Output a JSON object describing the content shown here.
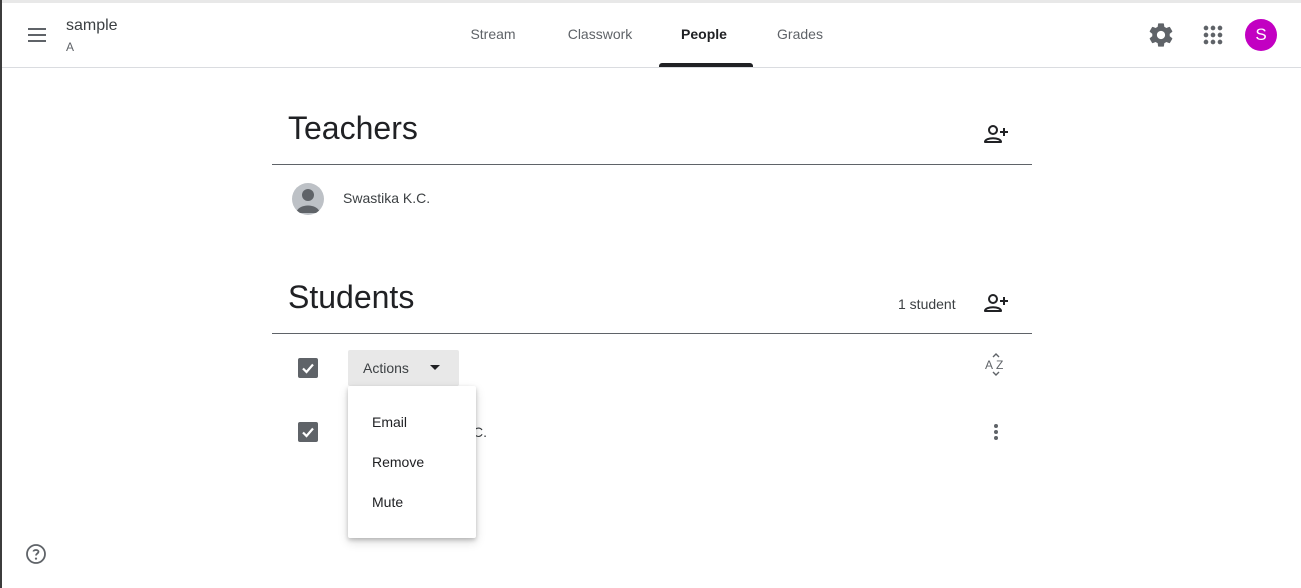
{
  "header": {
    "class_name": "sample",
    "section": "A",
    "tabs": [
      {
        "label": "Stream"
      },
      {
        "label": "Classwork"
      },
      {
        "label": "People",
        "active": true
      },
      {
        "label": "Grades"
      }
    ],
    "avatar_letter": "S",
    "avatar_color": "#c200c2",
    "icons": [
      "menu-icon",
      "settings-gear-icon",
      "apps-grid-icon"
    ]
  },
  "teachers": {
    "title": "Teachers",
    "list": [
      {
        "name": "Swastika K.C."
      }
    ]
  },
  "students": {
    "title": "Students",
    "count": "1 student",
    "actions_label": "Actions",
    "visible_name_fragment": "C.",
    "menu": {
      "items": [
        {
          "label": "Email"
        },
        {
          "label": "Remove"
        },
        {
          "label": "Mute"
        }
      ]
    }
  },
  "colors": {
    "text_primary": "#202124",
    "text_secondary": "#5f6368",
    "checkbox": "#5f6368",
    "actions_bg": "#e8e8e8"
  }
}
